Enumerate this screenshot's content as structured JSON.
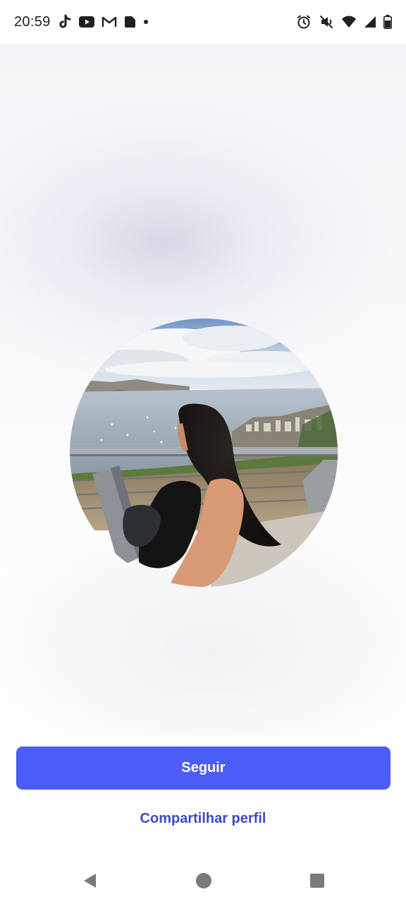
{
  "status_bar": {
    "time": "20:59",
    "left_icons": [
      "tiktok-icon",
      "youtube-icon",
      "gmail-icon",
      "app-icon",
      "dot-icon"
    ],
    "right_icons": [
      "alarm-icon",
      "mute-icon",
      "wifi-icon",
      "signal-icon",
      "battery-icon"
    ]
  },
  "profile": {
    "avatar": "profile-photo"
  },
  "actions": {
    "follow_label": "Seguir",
    "share_label": "Compartilhar perfil"
  },
  "colors": {
    "primary": "#4b5cf7",
    "link": "#3c4ac8",
    "text": "#202124",
    "nav_icon": "#7a7a7a"
  },
  "navigation": {
    "icons": [
      "back-icon",
      "home-icon",
      "recents-icon"
    ]
  }
}
